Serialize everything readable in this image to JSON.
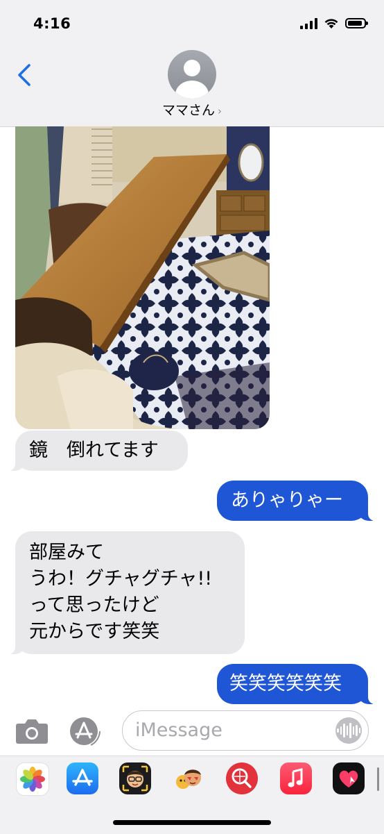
{
  "status_bar": {
    "time": "4:16"
  },
  "header": {
    "contact_name": "ママさん",
    "chevron": "›"
  },
  "messages": [
    {
      "direction": "incoming",
      "type": "photo"
    },
    {
      "direction": "incoming",
      "type": "text",
      "text": "鏡　倒れてます"
    },
    {
      "direction": "outgoing",
      "type": "text",
      "text": "ありゃりゃー"
    },
    {
      "direction": "incoming",
      "type": "text",
      "text": "部屋みて\nうわ！グチャグチャ!!\nって思ったけど\n元からです笑笑"
    },
    {
      "direction": "outgoing",
      "type": "text",
      "text": "笑笑笑笑笑笑"
    }
  ],
  "input_bar": {
    "placeholder": "iMessage"
  },
  "app_drawer": {
    "apps": [
      "photos-icon",
      "app-store-icon",
      "memoji-icon",
      "animoji-icon",
      "image-search-icon",
      "music-icon",
      "digital-touch-icon"
    ]
  },
  "colors": {
    "outgoing_bubble": "#1f56d6",
    "incoming_bubble": "#e9e9eb",
    "accent": "#1f6ee8",
    "header_bg": "#f1f1f3"
  }
}
